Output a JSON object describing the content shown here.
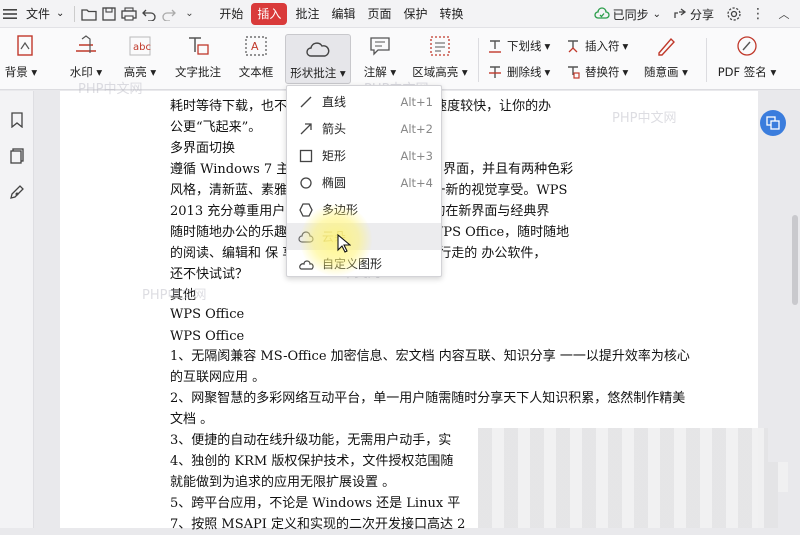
{
  "menubar": {
    "file": "文件",
    "tabs": [
      "开始",
      "插入",
      "批注",
      "编辑",
      "页面",
      "保护",
      "转换"
    ],
    "active_tab": "插入",
    "sync": "已同步",
    "share": "分享"
  },
  "ribbon": {
    "page_bg": "背景",
    "watermark": "水印",
    "highlight": "高亮",
    "text_note": "文字批注",
    "textbox": "文本框",
    "shape_note": "形状批注",
    "annotate": "注解",
    "area_highlight": "区域高亮",
    "underline": "下划线",
    "strikethrough": "删除线",
    "insert_mark": "插入符",
    "replace_mark": "替换符",
    "freehand": "随意画",
    "pdf_sign": "PDF 签名"
  },
  "dropdown": {
    "items": [
      {
        "label": "直线",
        "shortcut": "Alt+1",
        "icon": "line-icon"
      },
      {
        "label": "箭头",
        "shortcut": "Alt+2",
        "icon": "arrow-icon"
      },
      {
        "label": "矩形",
        "shortcut": "Alt+3",
        "icon": "rectangle-icon"
      },
      {
        "label": "椭圆",
        "shortcut": "Alt+4",
        "icon": "ellipse-icon"
      },
      {
        "label": "多边形",
        "shortcut": "",
        "icon": "polygon-icon"
      },
      {
        "label": "云朵",
        "shortcut": "",
        "icon": "cloud-icon"
      },
      {
        "label": "自定义图形",
        "shortcut": "",
        "icon": "custom-shape-icon"
      }
    ],
    "hovered": "云朵"
  },
  "document": {
    "lines": [
      "耗时等待下载，也不                                分钟即可下载安装，启动速度较快，让你的办",
      "公更“飞起来”。",
      "多界面切换",
      "遵循 Windows 7 主                      面，metro 风格的 2013 界面，并且有两种色彩",
      "风格，清新蓝、素雅                      2003 风格，赋予你焕然一新的视觉享受。WPS",
      "2013 充分尊重用户                       面切换，用户可以无障碍的在新界面与经典界",
      "随时随地办公的乐趣                      、Android 平台的移动 WPS Office，随时随地",
      "的阅读、编辑和 保                          享给工作伙伴，跟随你各处行走的 办公软件，",
      "还不快试试？",
      "其他",
      "WPS Office",
      "WPS Office",
      "1、无隔阂兼容 MS-Office 加密信息、宏文档 内容互联、知识分享 一一以提升效率为核心",
      "的互联网应用 。",
      "2、网聚智慧的多彩网络互动平台，单一用户随需随时分享天下人知识积累，悠然制作精美",
      "文档 。",
      "3、便捷的自动在线升级功能，无需用户动手，实",
      "4、独创的 KRM 版权保护技术，文件授权范围随",
      "就能做到为追求的应用无限扩展设置 。",
      "5、跨平台应用，不论是 Windows 还是 Linux 平",
      "7、按照 MSAPI 定义和实现的二次开发接口高达 2"
    ]
  },
  "watermarks": [
    "PHP中文网",
    "PHP中文网",
    "PHP中文网",
    "PHP中文网",
    "PHP中文网"
  ],
  "colors": {
    "accent": "#d93a3a",
    "blue": "#3b7ddd"
  }
}
